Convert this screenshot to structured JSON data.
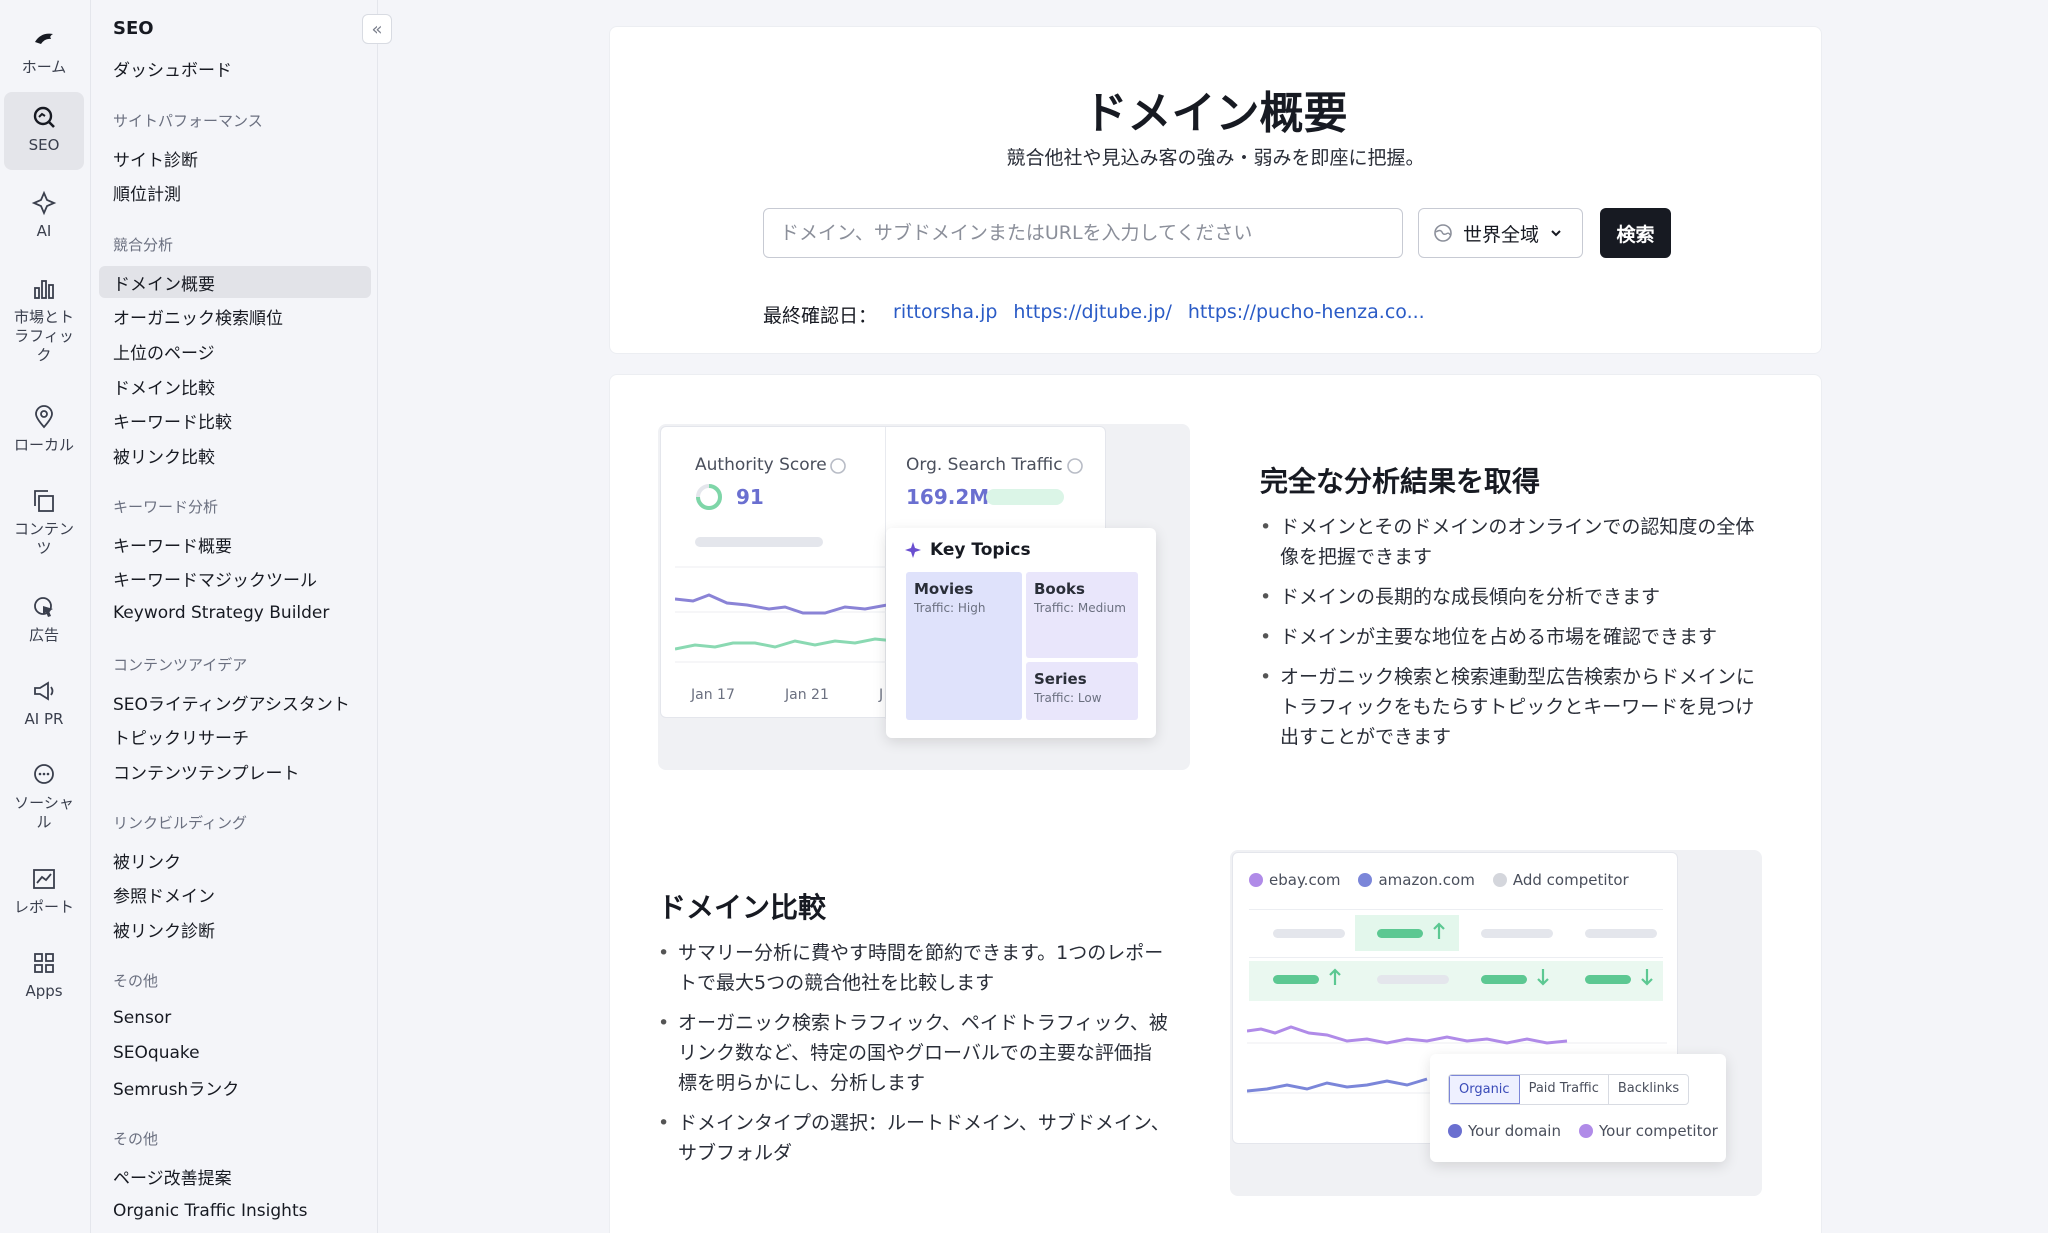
{
  "rail": [
    {
      "label": "ホーム",
      "icon": "bird-logo-icon",
      "active": false
    },
    {
      "label": "SEO",
      "icon": "seo-icon",
      "active": true
    },
    {
      "label": "AI",
      "icon": "ai-icon",
      "active": false
    },
    {
      "label": "市場とトラフィック",
      "icon": "chart-bar-icon",
      "active": false
    },
    {
      "label": "ローカル",
      "icon": "map-pin-icon",
      "active": false
    },
    {
      "label": "コンテンツ",
      "icon": "content-icon",
      "active": false
    },
    {
      "label": "広告",
      "icon": "ads-cursor-icon",
      "active": false
    },
    {
      "label": "AI PR",
      "icon": "megaphone-icon",
      "active": false
    },
    {
      "label": "ソーシャル",
      "icon": "chat-bubble-icon",
      "active": false
    },
    {
      "label": "レポート",
      "icon": "report-chart-icon",
      "active": false
    },
    {
      "label": "Apps",
      "icon": "apps-grid-icon",
      "active": false
    }
  ],
  "nav": {
    "title": "SEO",
    "collapse_label": "«",
    "dashboard": "ダッシュボード",
    "sections": [
      {
        "title": "サイトパフォーマンス",
        "items": [
          "サイト診断",
          "順位計測"
        ]
      },
      {
        "title": "競合分析",
        "items": [
          "ドメイン概要",
          "オーガニック検索順位",
          "上位のページ",
          "ドメイン比較",
          "キーワード比較",
          "被リンク比較"
        ]
      },
      {
        "title": "キーワード分析",
        "items": [
          "キーワード概要",
          "キーワードマジックツール",
          "Keyword Strategy Builder"
        ]
      },
      {
        "title": "コンテンツアイデア",
        "items": [
          "SEOライティングアシスタント",
          "トピックリサーチ",
          "コンテンツテンプレート"
        ]
      },
      {
        "title": "リンクビルディング",
        "items": [
          "被リンク",
          "参照ドメイン",
          "被リンク診断"
        ]
      },
      {
        "title": "その他",
        "items": [
          "Sensor",
          "SEOquake",
          "Semrushランク"
        ]
      },
      {
        "title": "その他",
        "items": [
          "ページ改善提案",
          "Organic Traffic Insights"
        ]
      }
    ],
    "active_item": "ドメイン概要"
  },
  "hero": {
    "title": "ドメイン概要",
    "subtitle": "競合他社や見込み客の強み・弱みを即座に把握。",
    "search_placeholder": "ドメイン、サブドメインまたはURLを入力してください",
    "search_value": "",
    "region": "世界全域",
    "search_button": "検索",
    "recent_label": "最終確認日：",
    "recent_links": [
      "rittorsha.jp",
      "https://djtube.jp/",
      "https://pucho-henza.co..."
    ]
  },
  "feature1": {
    "title": "完全な分析結果を取得",
    "bullets": [
      "ドメインとそのドメインのオンラインでの認知度の全体像を把握できます",
      "ドメインの長期的な成長傾向を分析できます",
      "ドメインが主要な地位を占める市場を確認できます",
      "オーガニック検索と検索連動型広告検索からドメインにトラフィックをもたらすトピックとキーワードを見つけ出すことができます"
    ],
    "illustration": {
      "authority_label": "Authority Score",
      "authority_value": "91",
      "traffic_label": "Org. Search Traffic",
      "traffic_value": "169.2M",
      "dates": [
        "Jan 17",
        "Jan 21",
        "J"
      ],
      "key_topics_title": "Key Topics",
      "topics": [
        {
          "name": "Movies",
          "traffic": "Traffic: High"
        },
        {
          "name": "Books",
          "traffic": "Traffic: Medium"
        },
        {
          "name": "Series",
          "traffic": "Traffic: Low"
        }
      ]
    }
  },
  "feature2": {
    "title": "ドメイン比較",
    "bullets": [
      "サマリー分析に費やす時間を節約できます。1つのレポートで最大5つの競合他社を比較します",
      "オーガニック検索トラフィック、ペイドトラフィック、被リンク数など、特定の国やグローバルでの主要な評価指標を明らかにし、分析します",
      "ドメインタイプの選択：ルートドメイン、サブドメイン、サブフォルダ"
    ],
    "illustration": {
      "domains": [
        "ebay.com",
        "amazon.com",
        "Add competitor"
      ],
      "tabs": [
        "Organic",
        "Paid Traffic",
        "Backlinks"
      ],
      "legend": [
        "Your domain",
        "Your competitor"
      ]
    }
  },
  "colors": {
    "accent_purple": "#7b6cd9",
    "accent_green": "#7ed6a8",
    "link": "#2a5bc6"
  }
}
